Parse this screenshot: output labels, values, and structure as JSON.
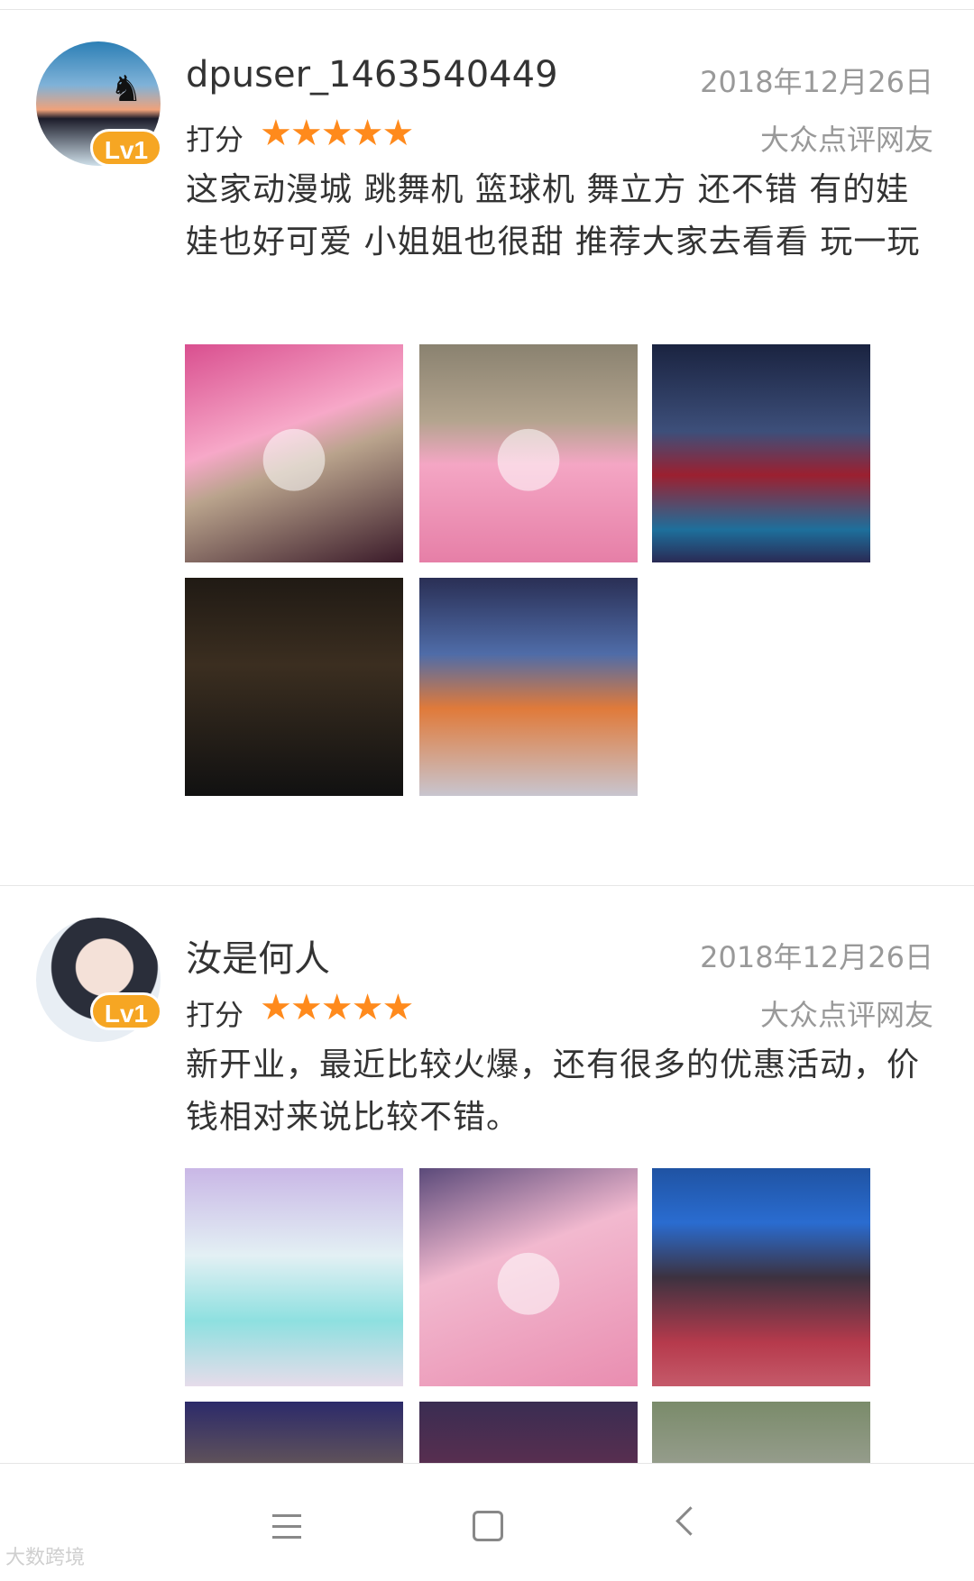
{
  "reviews": [
    {
      "username": "dpuser_1463540449",
      "level": "Lv1",
      "date": "2018年12月26日",
      "rating_label": "打分",
      "stars": 5,
      "source": "大众点评网友",
      "content": "这家动漫城 跳舞机 篮球机 舞立方 还不错 有的娃娃也好可爱 小姐姐也很甜 推荐大家去看看 玩一玩",
      "photo_count": 5
    },
    {
      "username": "汝是何人",
      "level": "Lv1",
      "date": "2018年12月26日",
      "rating_label": "打分",
      "stars": 5,
      "source": "大众点评网友",
      "content": "新开业，最近比较火爆，还有很多的优惠活动，价钱相对来说比较不错。",
      "photo_count": 6
    }
  ],
  "nav": {
    "icons": [
      "menu-icon",
      "home-icon",
      "back-icon"
    ]
  },
  "colors": {
    "star": "#ff8a1c",
    "level_badge": "#f6a623",
    "muted_text": "#999999",
    "body_text": "#333333"
  },
  "watermark": "大数跨境"
}
